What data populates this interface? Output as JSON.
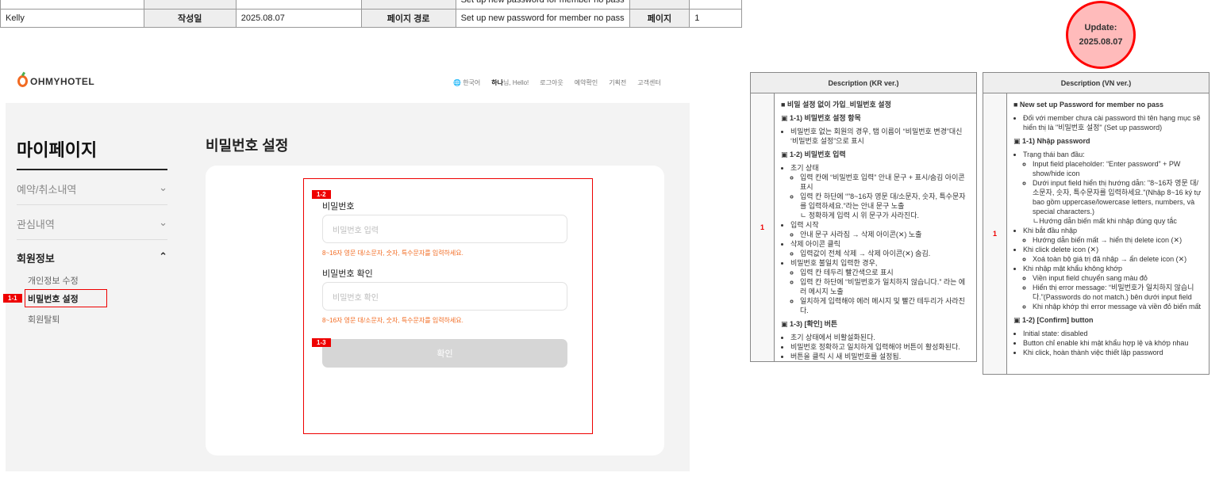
{
  "meta": {
    "author": "Kelly",
    "date_label": "작성일",
    "date": "2025.08.07",
    "path_label": "페이지 경로",
    "path": "Set up new password for member no pass",
    "page_label": "페이지",
    "page": "1",
    "top_path": "Set up new password for member no pass"
  },
  "update": {
    "label": "Update:",
    "date": "2025.08.07"
  },
  "header": {
    "logo": "OHMYHOTEL",
    "lang": "한국어",
    "user_name": "하나",
    "user_greet": "님, Hello!",
    "logout": "로그아웃",
    "reservation": "예약확인",
    "promotion": "기획전",
    "support": "고객센터"
  },
  "sidebar": {
    "title": "마이페이지",
    "items": [
      {
        "label": "예약/취소내역"
      },
      {
        "label": "관심내역"
      },
      {
        "label": "회원정보"
      }
    ],
    "sub_items": [
      "개인정보 수정",
      "비밀번호 설정",
      "회원탈퇴"
    ]
  },
  "main": {
    "title": "비밀번호 설정",
    "pw_label": "비밀번호",
    "pw_placeholder": "비밀번호 입력",
    "hint": "8~16자 영문 대/소문자, 숫자, 특수문자를 입력하세요.",
    "pw2_label": "비밀번호 확인",
    "pw2_placeholder": "비밀번호 확인",
    "confirm": "확인"
  },
  "badges": {
    "b11": "1-1",
    "b12": "1-2",
    "b13": "1-3"
  },
  "colors": {
    "accent": "#f26b22",
    "annotation": "#ee0000"
  },
  "desc_kr": {
    "header": "Description (KR ver.)",
    "num": "1",
    "title": "■ 비밀 설정 없이 가입_비밀번호 설정",
    "s1": "▣ 1-1) 비밀번호 설정 항목",
    "s1_items": [
      "비밀번호 없는 회원의 경우, 탭 이름이 “비밀번호 변경”대신 ‘비밀번호 설정”으로 표시"
    ],
    "s2": "▣ 1-2) 비밀번호 입력",
    "s2_a": "초기 상태",
    "s2_a1": "입력 칸에 “비밀번호 입력” 안내 문구 + 표시/숨김 아이콘 표시",
    "s2_a2": "입력 칸 하단에 “”8~16자 영문 대/소문자, 숫자, 특수문자를 입력하세요.”라는 안내 문구 노출",
    "s2_a3": "ㄴ 정확하게 입력 시 위 문구가 사라진다.",
    "s2_b": "입력 시작",
    "s2_b1": "안내 문구 사라짐 → 삭제 아이콘(✕) 노출",
    "s2_c": "삭제 아이콘 클릭",
    "s2_c1": "입력값이 전체 삭제 → 삭제 아이콘(✕) 숨김.",
    "s2_d": "비밀번호 불일치 입력한 경우,",
    "s2_d1": "입력 칸 테두리 빨간색으로 표시",
    "s2_d2": "입력 칸 하단에 “비밀번호가 일치하지 않습니다.” 라는 에러 메시지 노출",
    "s2_d3": "일치하게 입력해야 에러 메시지 및 빨간 테두리가 사라진다.",
    "s3": "▣ 1-3) [확인] 버튼",
    "s3_items": [
      "초기 상태에서 비활설화된다.",
      "비밀번호 정확하고 일치하게 입력해야 버튼이 활성화된다.",
      "버튼을 클릭 시 새 비밀번호를 설정됨."
    ]
  },
  "desc_vn": {
    "header": "Description (VN ver.)",
    "num": "1",
    "title": "■ New set up Password for member no pass",
    "intro": "Đối với member chưa cài password thì tên hạng mục sẽ hiển thị là \"비밀번호 설정\" (Set up password)",
    "s1": "▣ 1-1) Nhập password",
    "s1_a": "Trạng thái ban đầu:",
    "s1_a1": "Input field placeholder: “Enter password” + PW show/hide icon",
    "s1_a2": "Dưới input field hiển thị hướng dẫn: \"8~16자 영문 대/소문자, 숫자, 특수문자를 입력하세요.\"(Nhập 8~16 ký tự bao gồm uppercase/lowercase letters, numbers, và special characters.)",
    "s1_a3": "ㄴHướng dẫn biến mất khi nhập đúng quy tắc",
    "s1_b": "Khi bắt đầu nhập",
    "s1_b1": "Hướng dẫn biến mất → hiển thị delete icon (✕)",
    "s1_c": "Khi click delete icon (✕)",
    "s1_c1": "Xoá toàn bộ giá trị đã nhập → ẩn delete icon (✕)",
    "s1_d": "Khi nhập mật khẩu không khớp",
    "s1_d1": "Viền input field chuyển sang màu đỏ",
    "s1_d2": "Hiển thị error message: “비밀번호가 일치하지 않습니다.”(Passwords do not match.) bên dưới input field",
    "s1_d3": "Khi nhập khớp thì error message và viền đỏ biến mất",
    "s2": "▣ 1-2) [Confirm] button",
    "s2_items": [
      "Initial state: disabled",
      "Button chỉ enable khi mật khẩu hợp lệ và khớp nhau",
      "Khi click, hoàn thành việc thiết lập password"
    ]
  }
}
